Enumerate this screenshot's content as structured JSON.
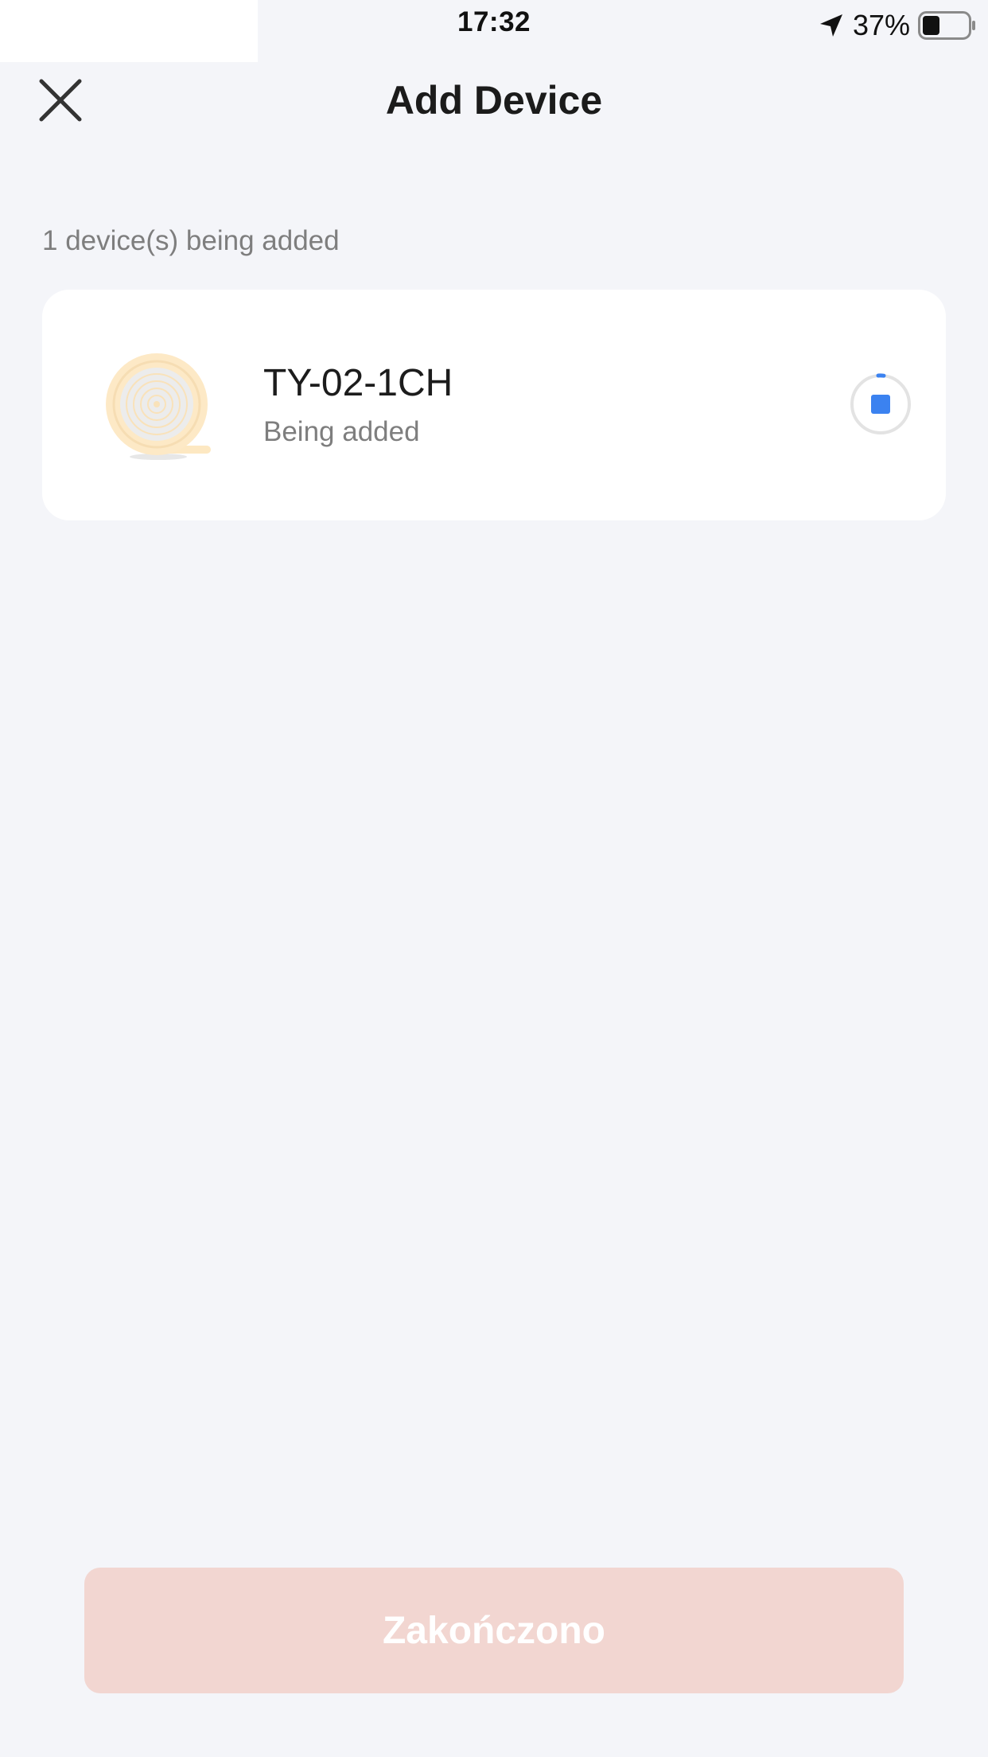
{
  "status_bar": {
    "time": "17:32",
    "battery_percent": "37%",
    "battery_level": 0.37,
    "icons": [
      "location-arrow-icon",
      "battery-icon"
    ]
  },
  "header": {
    "title": "Add Device",
    "close_icon": "close-icon"
  },
  "main": {
    "devices_count_text": "1 device(s) being added",
    "devices": [
      {
        "name": "TY-02-1CH",
        "status": "Being added",
        "image_icon": "device-image",
        "action_icon": "progress-stop-icon"
      }
    ]
  },
  "footer": {
    "finish_label": "Zakończono"
  },
  "colors": {
    "background": "#f4f5f9",
    "card": "#ffffff",
    "accent_blue": "#3b82f0",
    "finish_button_disabled": "#f2d6d1",
    "secondary_text": "#7e7e7e",
    "device_image_tint": "#fde8c2"
  }
}
